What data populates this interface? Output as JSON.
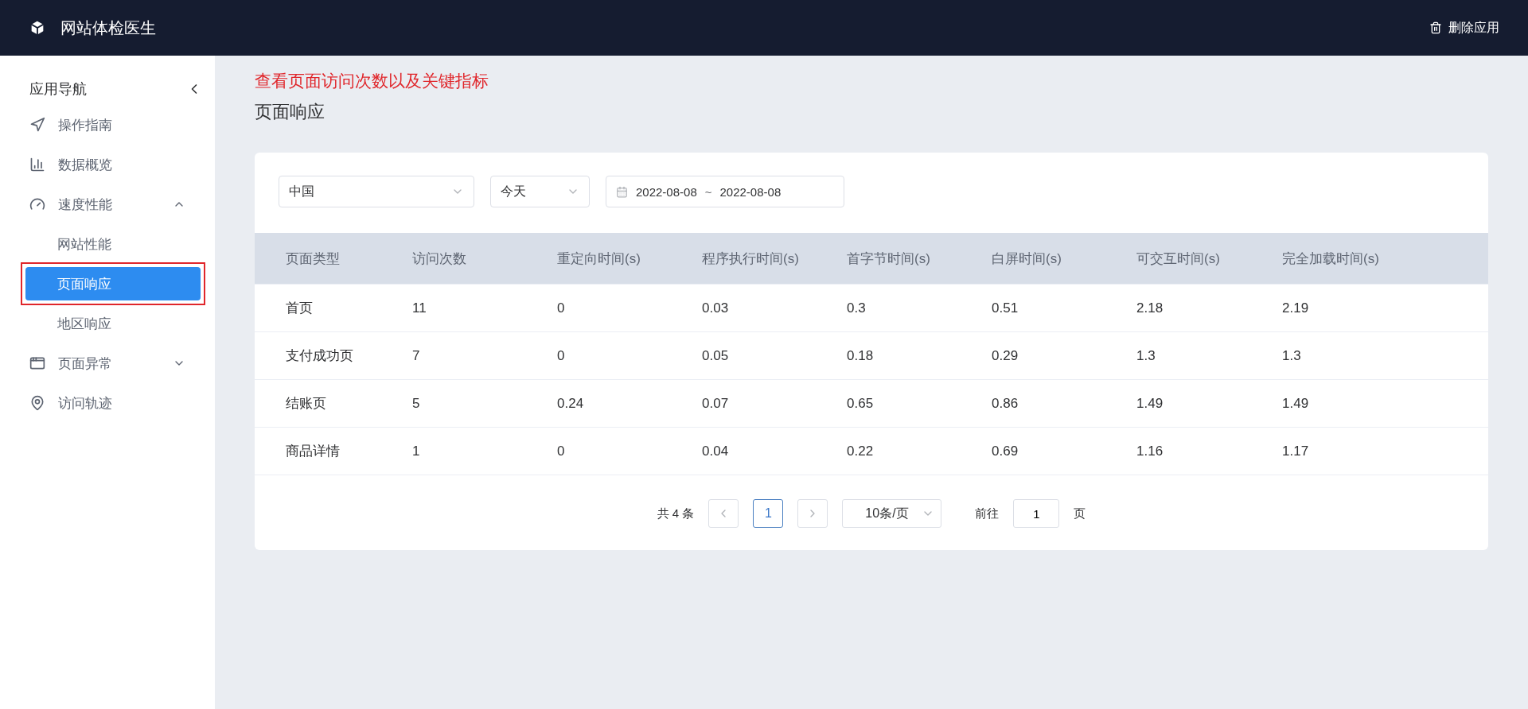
{
  "header": {
    "title": "网站体检医生",
    "action": "删除应用"
  },
  "sidebar": {
    "title": "应用导航",
    "items": [
      {
        "kind": "item",
        "label": "操作指南"
      },
      {
        "kind": "item",
        "label": "数据概览"
      },
      {
        "kind": "group",
        "label": "速度性能",
        "expanded": true,
        "children": [
          {
            "label": "网站性能",
            "selected": false,
            "annotated": false
          },
          {
            "label": "页面响应",
            "selected": true,
            "annotated": true
          },
          {
            "label": "地区响应",
            "selected": false,
            "annotated": false
          }
        ]
      },
      {
        "kind": "group",
        "label": "页面异常",
        "expanded": false
      },
      {
        "kind": "item",
        "label": "访问轨迹"
      }
    ]
  },
  "annotation": "查看页面访问次数以及关键指标",
  "page_title": "页面响应",
  "filters": {
    "region": "中国",
    "period": "今天",
    "date_start": "2022-08-08",
    "date_separator": "~",
    "date_end": "2022-08-08"
  },
  "table": {
    "columns": [
      "页面类型",
      "访问次数",
      "重定向时间(s)",
      "程序执行时间(s)",
      "首字节时间(s)",
      "白屏时间(s)",
      "可交互时间(s)",
      "完全加载时间(s)"
    ],
    "rows": [
      [
        "首页",
        "11",
        "0",
        "0.03",
        "0.3",
        "0.51",
        "2.18",
        "2.19"
      ],
      [
        "支付成功页",
        "7",
        "0",
        "0.05",
        "0.18",
        "0.29",
        "1.3",
        "1.3"
      ],
      [
        "结账页",
        "5",
        "0.24",
        "0.07",
        "0.65",
        "0.86",
        "1.49",
        "1.49"
      ],
      [
        "商品详情",
        "1",
        "0",
        "0.04",
        "0.22",
        "0.69",
        "1.16",
        "1.17"
      ]
    ]
  },
  "pagination": {
    "total": "共 4 条",
    "pages": [
      {
        "label": "1",
        "selected": true
      }
    ],
    "page_size": "10条/页",
    "goto_label": "前往",
    "goto_value": "1",
    "goto_suffix": "页"
  }
}
